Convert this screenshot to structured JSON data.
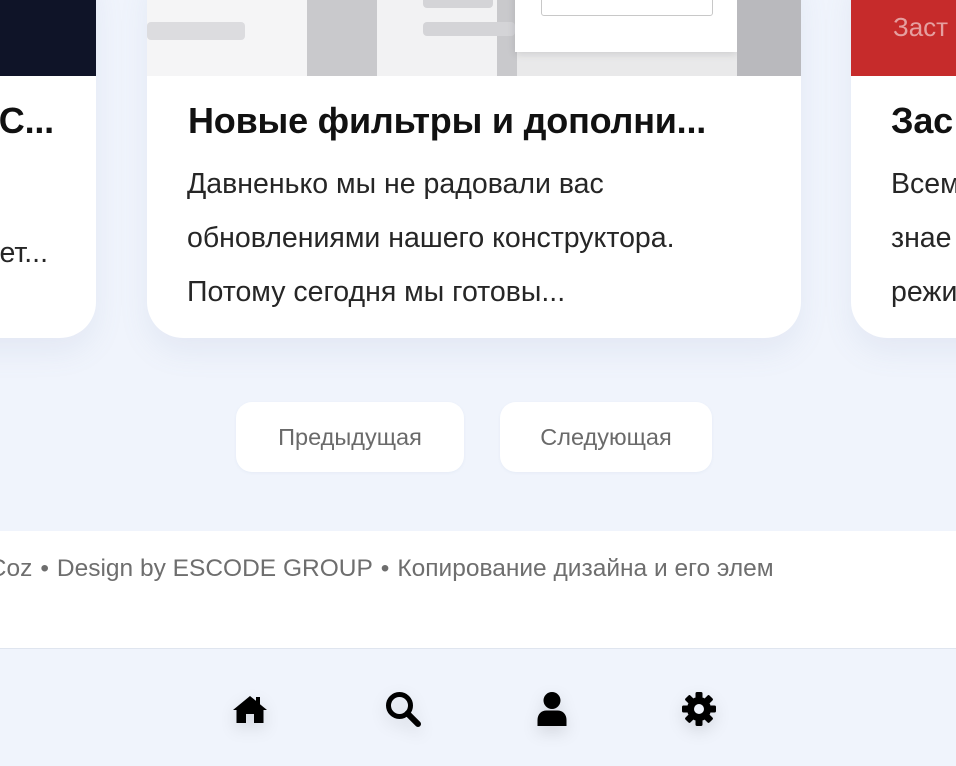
{
  "cards": {
    "left": {
      "title": "С...",
      "excerpt_lines": [
        "",
        "",
        "ет..."
      ]
    },
    "center": {
      "title": "Новые фильтры и дополни...",
      "excerpt_lines": [
        "Давненько мы не радовали вас",
        "обновлениями нашего конструктора.",
        "Потому сегодня мы готовы..."
      ]
    },
    "right": {
      "thumb_label": "Заст",
      "title": "Зас",
      "excerpt_lines": [
        "Всем",
        "знаe",
        "режи"
      ]
    }
  },
  "pagination": {
    "prev_label": "Предыдущая",
    "next_label": "Следующая"
  },
  "footer": {
    "part1": "й сайт с uCoz",
    "separator": "•",
    "part2": "Design by ESCODE GROUP",
    "part3": "Копирование дизайна и его элем"
  },
  "bottom_nav": {
    "items": [
      "home-icon",
      "search-icon",
      "user-icon",
      "gear-icon"
    ]
  },
  "colors": {
    "page_bg": "#f0f4fc",
    "card_bg": "#ffffff",
    "title_text": "#111111",
    "muted_text": "#6e6e6e",
    "right_thumb": "#c62b2b",
    "left_thumb": "#0f1428"
  }
}
